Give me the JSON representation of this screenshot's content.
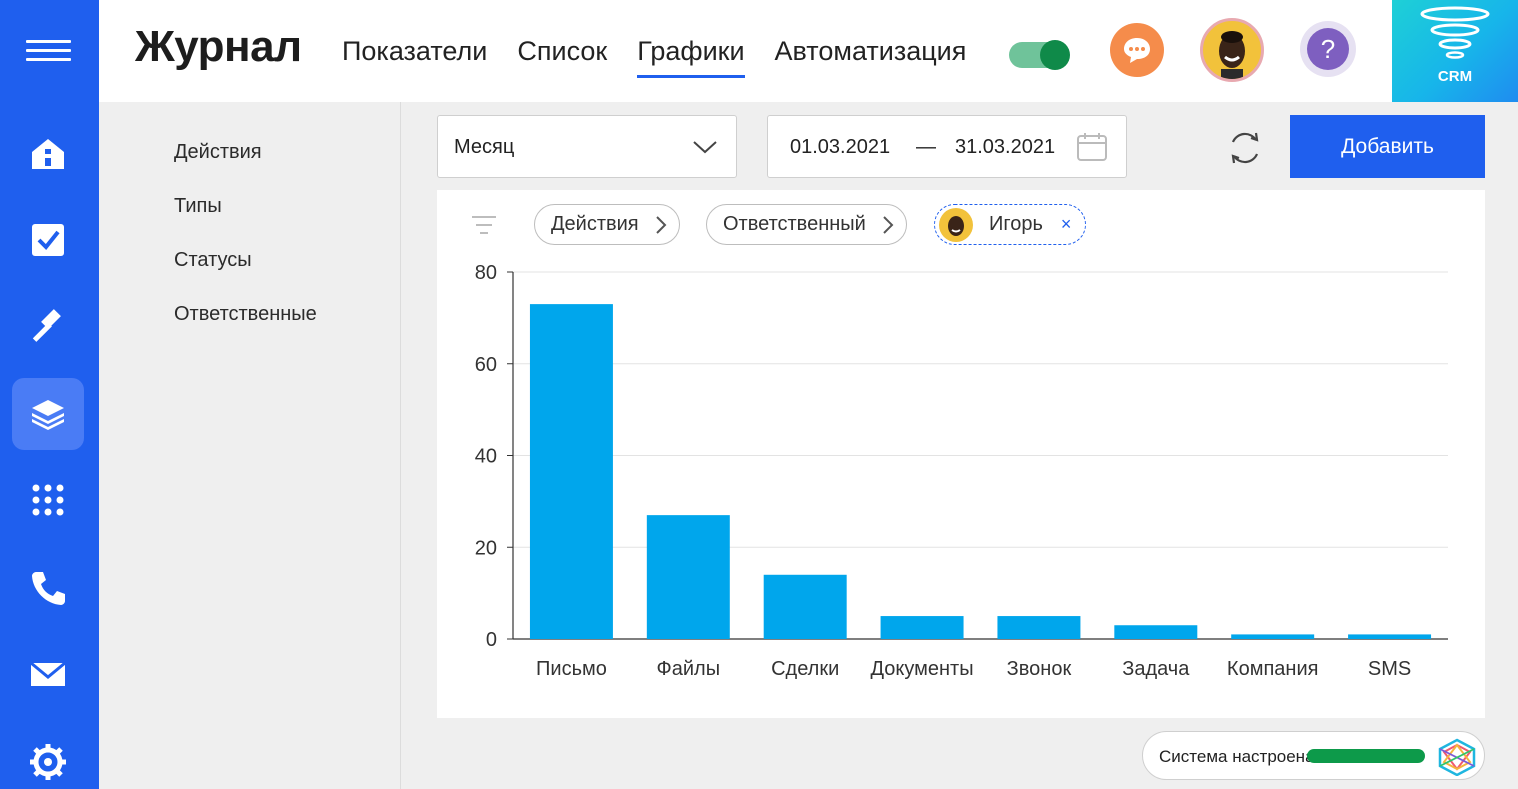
{
  "topbar": {
    "brand": "Журнал",
    "nav": [
      "Показатели",
      "Список",
      "Графики",
      "Автоматизация"
    ],
    "active_nav": "Графики",
    "toggle_on": true,
    "crm_label": "CRM"
  },
  "rail": {
    "items": [
      "home-icon",
      "tasks-icon",
      "auction-icon",
      "layers-icon",
      "apps-icon",
      "phone-icon",
      "mail-icon",
      "settings-icon"
    ],
    "active": "layers-icon"
  },
  "subnav": {
    "items": [
      "Действия",
      "Типы",
      "Статусы",
      "Ответственные"
    ]
  },
  "filters": {
    "period": "Месяц",
    "date_from": "01.03.2021",
    "date_sep": "—",
    "date_to": "31.03.2021",
    "add_label": "Добавить"
  },
  "breadcrumbs": {
    "chips": [
      "Действия",
      "Ответственный"
    ],
    "person": "Игорь",
    "remove": "×"
  },
  "colors": {
    "accent": "#1f5fee",
    "bar": "#00a6ec",
    "status_ok": "#0d9a4a"
  },
  "status": {
    "text": "Система настроена",
    "progress": 1.0
  },
  "chart_data": {
    "type": "bar",
    "categories": [
      "Письмо",
      "Файлы",
      "Сделки",
      "Документы",
      "Звонок",
      "Задача",
      "Компания",
      "SMS"
    ],
    "values": [
      73,
      27,
      14,
      5,
      5,
      3,
      1,
      1
    ],
    "yticks": [
      "0",
      "20",
      "40",
      "60",
      "80"
    ],
    "ylim": [
      0,
      80
    ],
    "grid": true,
    "legend": "none"
  }
}
